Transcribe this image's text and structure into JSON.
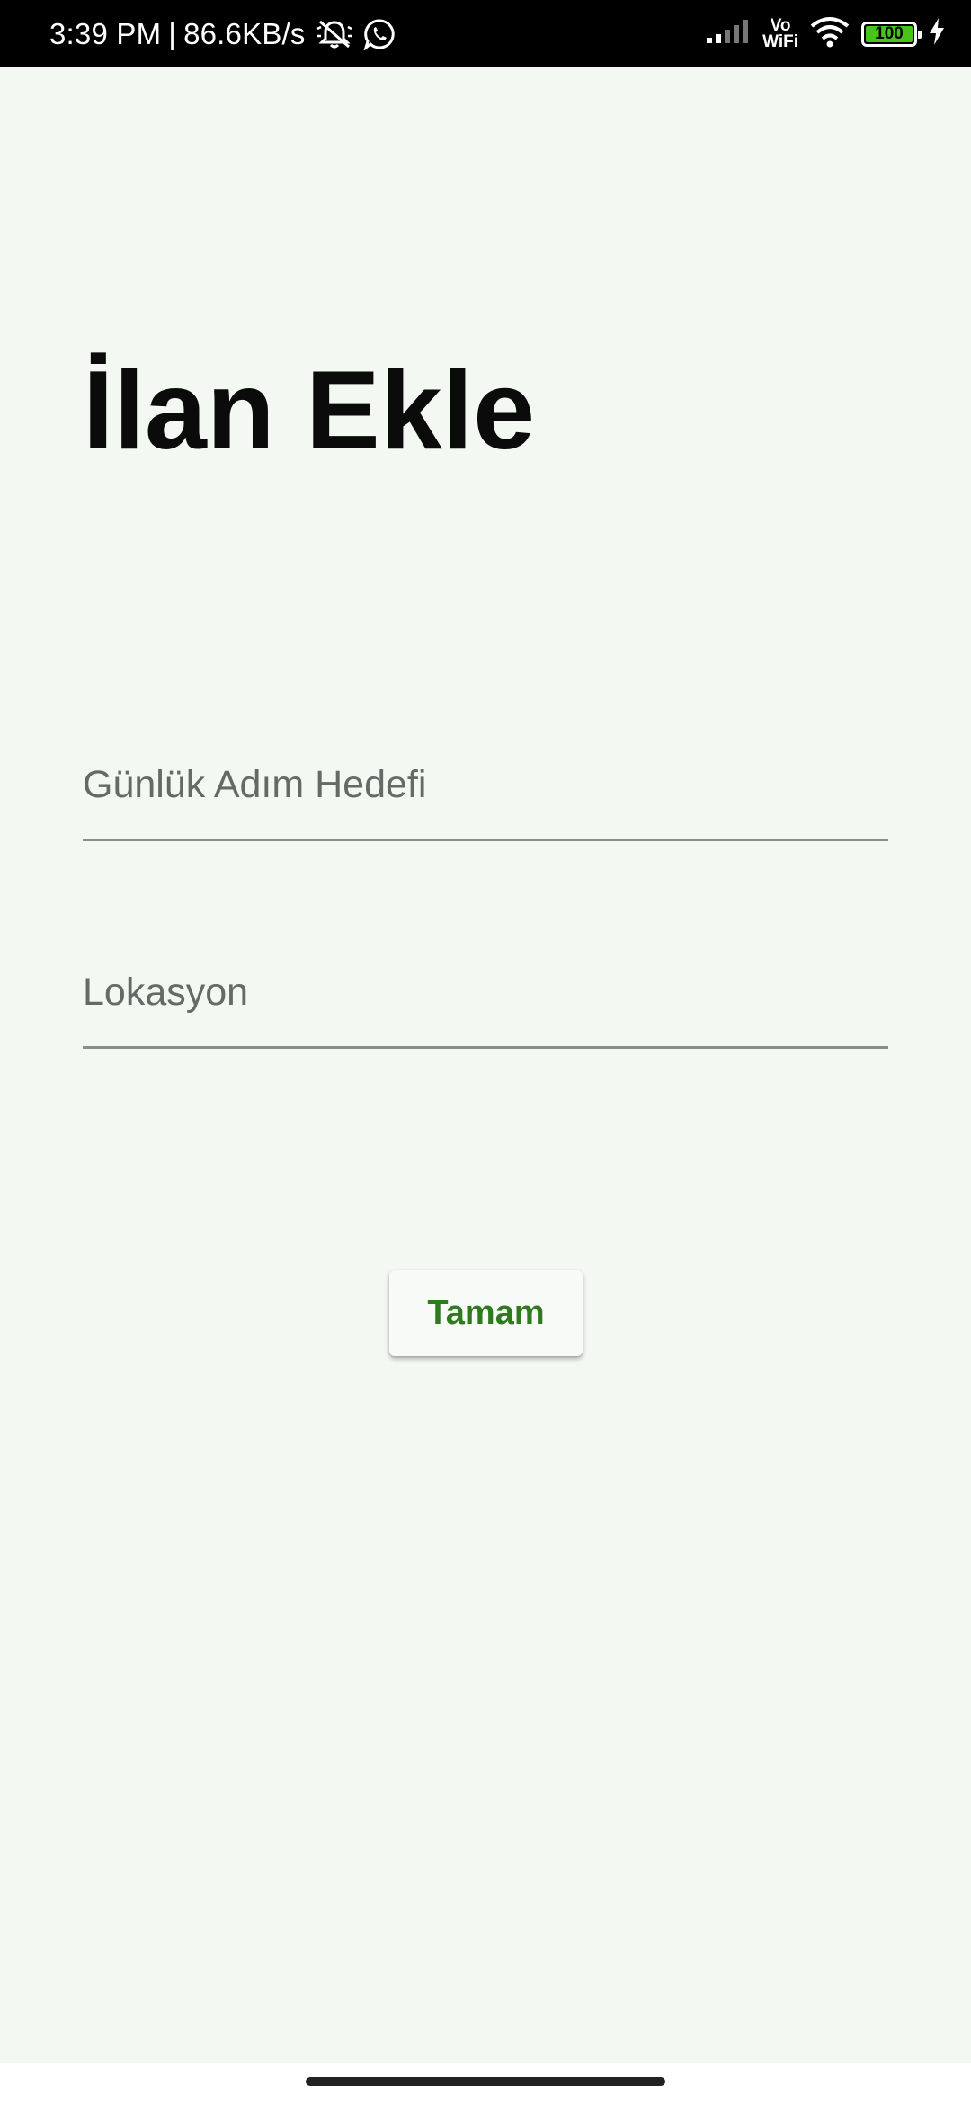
{
  "status_bar": {
    "time": "3:39 PM",
    "separator": "|",
    "network_speed": "86.6KB/s",
    "icons": [
      "mute-notification-icon",
      "whatsapp-icon",
      "signal-icon",
      "vowifi-icon",
      "wifi-icon",
      "battery-icon",
      "charging-icon"
    ],
    "vo_label": "Vo",
    "wifi_label": "WiFi",
    "battery_level": "100",
    "battery_color": "#48c31a"
  },
  "page": {
    "title": "İlan Ekle"
  },
  "form": {
    "daily_step_goal": {
      "placeholder": "Günlük Adım Hedefi",
      "value": ""
    },
    "location": {
      "placeholder": "Lokasyon",
      "value": ""
    },
    "submit_label": "Tamam",
    "accent_color": "#2f7a1f"
  },
  "colors": {
    "background": "#f3f8f3",
    "status_bar": "#000000"
  }
}
